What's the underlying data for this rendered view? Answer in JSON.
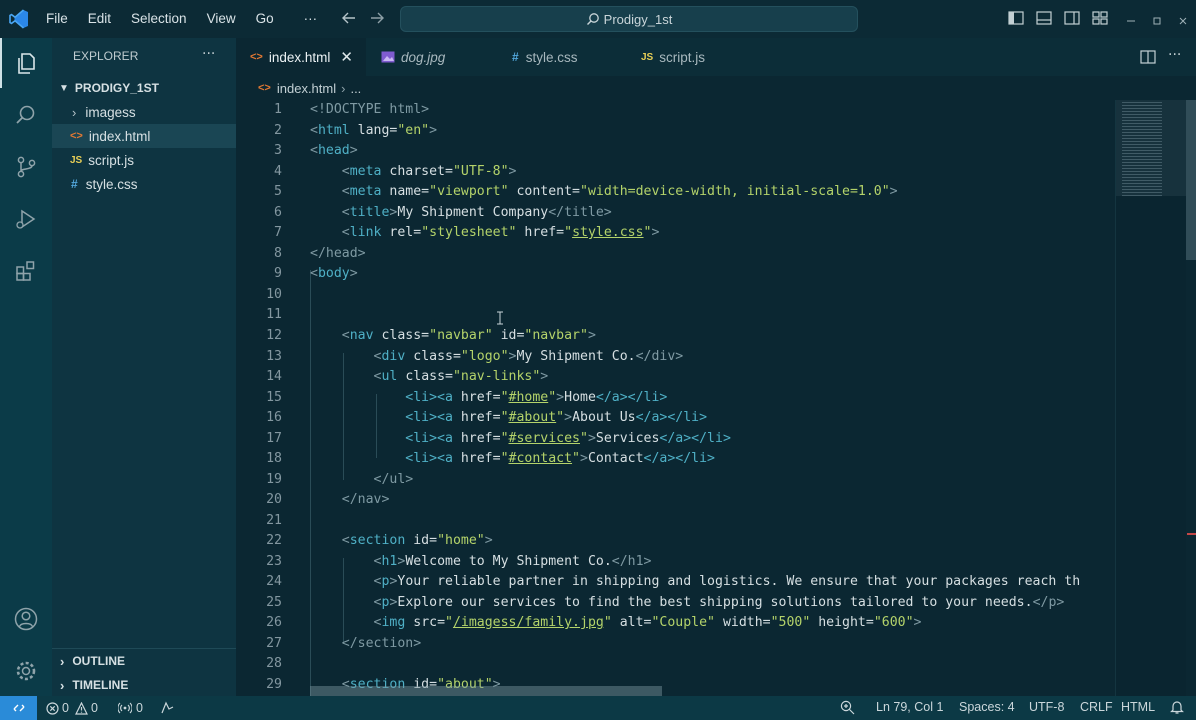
{
  "titlebar": {
    "menus": [
      "File",
      "Edit",
      "Selection",
      "View",
      "Go"
    ],
    "more": "···",
    "search_text": "Prodigy_1st"
  },
  "sidebar": {
    "title": "EXPLORER",
    "more": "···",
    "folder": "PRODIGY_1ST",
    "items": [
      {
        "label": "imagess",
        "icon": ">"
      },
      {
        "label": "index.html",
        "icon": "<>"
      },
      {
        "label": "script.js",
        "icon": "JS"
      },
      {
        "label": "style.css",
        "icon": "#"
      }
    ],
    "outline": "OUTLINE",
    "timeline": "TIMELINE"
  },
  "tabs": [
    {
      "label": "index.html",
      "icon": "<>"
    },
    {
      "label": "dog.jpg",
      "icon": "img"
    },
    {
      "label": "style.css",
      "icon": "#"
    },
    {
      "label": "script.js",
      "icon": "JS"
    }
  ],
  "breadcrumb": {
    "file": "index.html",
    "rest": "..."
  },
  "line_numbers": [
    "1",
    "2",
    "3",
    "4",
    "5",
    "6",
    "7",
    "8",
    "9",
    "10",
    "11",
    "12",
    "13",
    "14",
    "15",
    "16",
    "17",
    "18",
    "19",
    "20",
    "21",
    "22",
    "23",
    "24",
    "25",
    "26",
    "27",
    "28",
    "29"
  ],
  "code": {
    "l1": {
      "a": "<!DOCTYPE html>"
    },
    "l2": {
      "lt": "<",
      "tag": "html",
      "attr": " lang=",
      "val": "\"en\"",
      "gt": ">"
    },
    "l3": {
      "lt": "<",
      "tag": "head",
      "gt": ">"
    },
    "l4": {
      "lt": "<",
      "tag": "meta",
      "attr": " charset=",
      "val": "\"UTF-8\"",
      "gt": ">"
    },
    "l5": {
      "lt": "<",
      "tag": "meta",
      "attr1": " name=",
      "val1": "\"viewport\"",
      "attr2": " content=",
      "val2": "\"width=device-width, initial-scale=1.0\"",
      "gt": ">"
    },
    "l6": {
      "lt": "<",
      "tag": "title",
      "gt": ">",
      "text": "My Shipment Company",
      "close": "</title>"
    },
    "l7": {
      "lt": "<",
      "tag": "link",
      "attr1": " rel=",
      "val1": "\"stylesheet\"",
      "attr2": " href=",
      "q1": "\"",
      "link": "style.css",
      "q2": "\"",
      "gt": ">"
    },
    "l8": {
      "a": "</head>"
    },
    "l9": {
      "lt": "<",
      "tag": "body",
      "gt": ">"
    },
    "l12": {
      "lt": "<",
      "tag": "nav",
      "attr1": " class=",
      "val1": "\"navbar\"",
      "attr2": " id=",
      "val2": "\"navbar\"",
      "gt": ">"
    },
    "l13": {
      "lt": "<",
      "tag": "div",
      "attr": " class=",
      "val": "\"logo\"",
      "gt": ">",
      "text": "My Shipment Co.",
      "close": "</div>"
    },
    "l14": {
      "lt": "<",
      "tag": "ul",
      "attr": " class=",
      "val": "\"nav-links\"",
      "gt": ">"
    },
    "l15": {
      "pre": "<li><a",
      "attr": " href=",
      "q1": "\"",
      "link": "#home",
      "q2": "\"",
      "gt": ">",
      "text": "Home",
      "close": "</a></li>"
    },
    "l16": {
      "pre": "<li><a",
      "attr": " href=",
      "q1": "\"",
      "link": "#about",
      "q2": "\"",
      "gt": ">",
      "text": "About Us",
      "close": "</a></li>"
    },
    "l17": {
      "pre": "<li><a",
      "attr": " href=",
      "q1": "\"",
      "link": "#services",
      "q2": "\"",
      "gt": ">",
      "text": "Services",
      "close": "</a></li>"
    },
    "l18": {
      "pre": "<li><a",
      "attr": " href=",
      "q1": "\"",
      "link": "#contact",
      "q2": "\"",
      "gt": ">",
      "text": "Contact",
      "close": "</a></li>"
    },
    "l19": {
      "a": "</ul>"
    },
    "l20": {
      "a": "</nav>"
    },
    "l22": {
      "lt": "<",
      "tag": "section",
      "attr": " id=",
      "val": "\"home\"",
      "gt": ">"
    },
    "l23": {
      "lt": "<",
      "tag": "h1",
      "gt": ">",
      "text": "Welcome to My Shipment Co.",
      "close": "</h1>"
    },
    "l24": {
      "lt": "<",
      "tag": "p",
      "gt": ">",
      "text": "Your reliable partner in shipping and logistics. We ensure that your packages reach th"
    },
    "l25": {
      "lt": "<",
      "tag": "p",
      "gt": ">",
      "text": "Explore our services to find the best shipping solutions tailored to your needs.",
      "close": "</p>"
    },
    "l26": {
      "lt": "<",
      "tag": "img",
      "attr1": " src=",
      "q1": "\"",
      "link": "/imagess/family.jpg",
      "q2": "\"",
      "attr2": " alt=",
      "val2": "\"Couple\"",
      "attr3": " width=",
      "val3": "\"500\"",
      "attr4": " height=",
      "val4": "\"600\"",
      "gt": ">"
    },
    "l27": {
      "a": "</section>"
    },
    "l29": {
      "lt": "<",
      "tag": "section",
      "attr": " id=",
      "val": "\"about\"",
      "gt": ">"
    }
  },
  "status": {
    "errors": "0",
    "warnings": "0",
    "ports": "0",
    "position": "Ln 79, Col 1",
    "spaces": "Spaces: 4",
    "encoding": "UTF-8",
    "eol": "CRLF",
    "language": "HTML"
  },
  "colors": {
    "tag": "#4fb0c6",
    "string": "#b4d36a",
    "accent": "#2b87e8"
  }
}
